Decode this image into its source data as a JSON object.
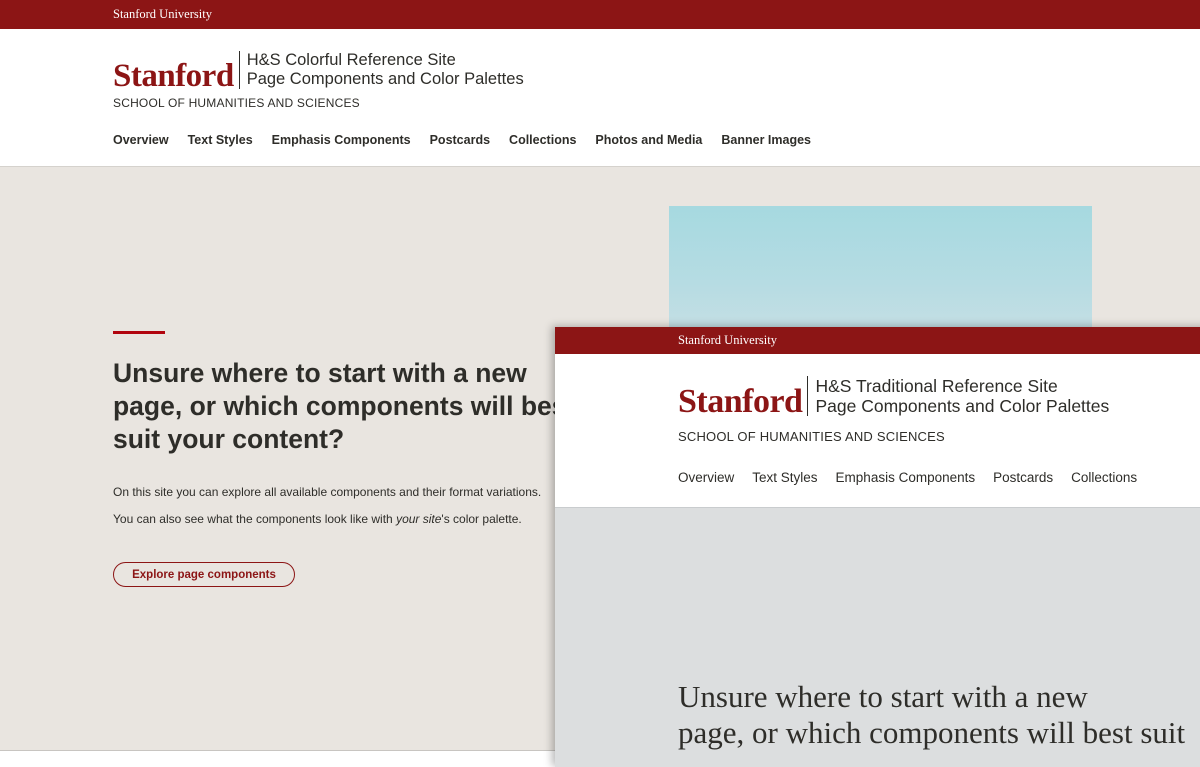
{
  "colorful": {
    "topbar_label": "Stanford University",
    "wordmark": "Stanford",
    "site_title": "H&S Colorful Reference Site",
    "site_subtitle": "Page Components and Color Palettes",
    "school": "SCHOOL OF HUMANITIES AND SCIENCES",
    "nav": [
      "Overview",
      "Text Styles",
      "Emphasis Components",
      "Postcards",
      "Collections",
      "Photos and Media",
      "Banner Images"
    ],
    "hero": {
      "heading": "Unsure where to start with a new page, or which components will best suit your content?",
      "paragraph1": "On this site you can explore all available components and their format variations.",
      "paragraph2_before": "You can also see what the components look like with ",
      "paragraph2_em": "your site",
      "paragraph2_after": "'s color palette.",
      "button_label": "Explore page components"
    }
  },
  "traditional": {
    "topbar_label": "Stanford University",
    "wordmark": "Stanford",
    "site_title": "H&S Traditional Reference Site",
    "site_subtitle": "Page Components and Color Palettes",
    "school": "SCHOOL OF HUMANITIES AND SCIENCES",
    "nav": [
      "Overview",
      "Text Styles",
      "Emphasis Components",
      "Postcards",
      "Collections"
    ],
    "hero": {
      "heading_line1": "Unsure where to start with a new",
      "heading_line2": "page, or which components will best suit"
    }
  },
  "colors": {
    "cardinal": "#8c1515",
    "text": "#2e2d29",
    "colorful_hero_bg": "#e9e5e0",
    "traditional_hero_bg": "#dcdedf",
    "accent_line": "#b1040e"
  }
}
